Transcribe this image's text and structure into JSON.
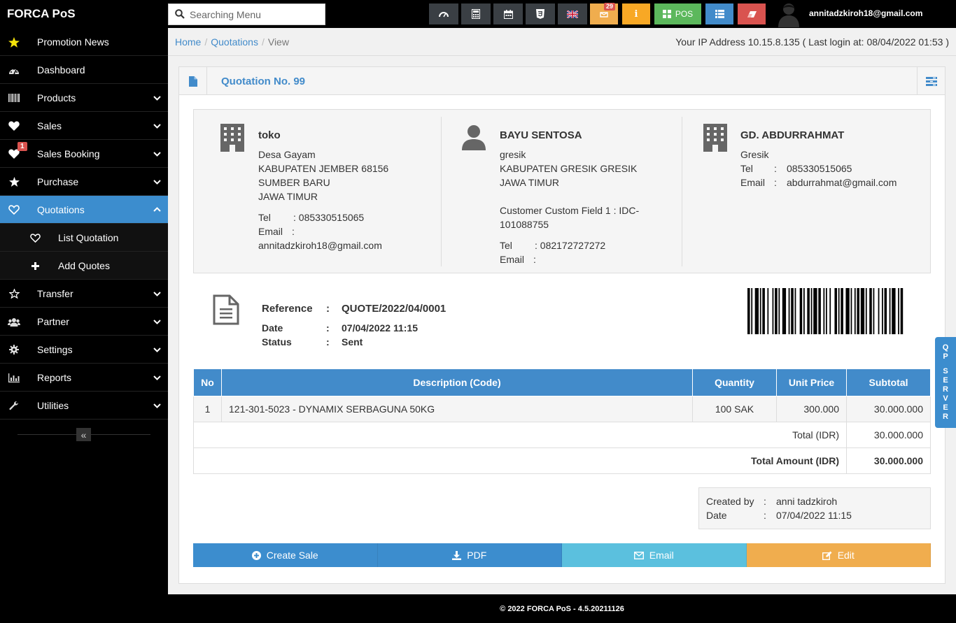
{
  "brand": "FORCA PoS",
  "search": {
    "placeholder": "Searching Menu"
  },
  "topbar": {
    "notifications_count": "29",
    "pos_label": "POS",
    "user_email": "annitadzkiroh18@gmail.com",
    "icons": [
      "dashboard-icon",
      "calculator-icon",
      "calendar-icon",
      "css-icon",
      "uk-flag-icon",
      "notification-icon",
      "info-icon",
      "pos-grid-icon",
      "list-icon",
      "eraser-icon"
    ]
  },
  "sidebar": {
    "items": [
      {
        "label": "Promotion News",
        "icon": "star-icon"
      },
      {
        "label": "Dashboard",
        "icon": "dashboard-icon"
      },
      {
        "label": "Products",
        "icon": "barcode-icon"
      },
      {
        "label": "Sales",
        "icon": "heart-icon"
      },
      {
        "label": "Sales Booking",
        "icon": "heart-icon",
        "badge": "1"
      },
      {
        "label": "Purchase",
        "icon": "star-icon"
      },
      {
        "label": "Quotations",
        "icon": "heart-outline-icon"
      },
      {
        "label": "Transfer",
        "icon": "star-outline-icon"
      },
      {
        "label": "Partner",
        "icon": "users-icon"
      },
      {
        "label": "Settings",
        "icon": "gear-icon"
      },
      {
        "label": "Reports",
        "icon": "bar-chart-icon"
      },
      {
        "label": "Utilities",
        "icon": "wrench-icon"
      }
    ],
    "subitems": [
      {
        "label": "List Quotation"
      },
      {
        "label": "Add Quotes"
      }
    ],
    "collapse_glyph": "«"
  },
  "breadcrumb": {
    "home": "Home",
    "quotations": "Quotations",
    "current": "View",
    "sep": "/"
  },
  "ip_info": "Your IP Address 10.15.8.135 ( Last login at: 08/04/2022 01:53 )",
  "quotation": {
    "title": "Quotation No. 99",
    "biller": {
      "name": "toko",
      "addr1": "Desa Gayam",
      "addr2": "KABUPATEN JEMBER 68156",
      "addr3": "SUMBER BARU",
      "addr4": "JAWA TIMUR",
      "tel_label": "Tel",
      "tel": ": 085330515065",
      "email_label": "Email",
      "email_sep": ":",
      "email": "annitadzkiroh18@gmail.com"
    },
    "customer": {
      "name": "BAYU SENTOSA",
      "addr1": "gresik",
      "addr2": "KABUPATEN GRESIK GRESIK",
      "addr3": "JAWA TIMUR",
      "custom1": "Customer Custom Field 1 : IDC-",
      "custom2": "101088755",
      "tel_label": "Tel",
      "tel": ": 082172727272",
      "email_label": "Email",
      "email_sep": ":"
    },
    "warehouse": {
      "name": "GD. ABDURRAHMAT",
      "addr1": "Gresik",
      "tel_label": "Tel",
      "tel_sep": ":",
      "tel": "085330515065",
      "email_label": "Email",
      "email_sep": ":",
      "email": "abdurrahmat@gmail.com"
    },
    "reference_label": "Reference",
    "reference": "QUOTE/2022/04/0001",
    "date_label": "Date",
    "date": "07/04/2022 11:15",
    "status_label": "Status",
    "status": "Sent",
    "colon": ":"
  },
  "table": {
    "headers": [
      "No",
      "Description (Code)",
      "Quantity",
      "Unit Price",
      "Subtotal"
    ],
    "rows": [
      {
        "no": "1",
        "desc": "121-301-5023 - DYNAMIX SERBAGUNA 50KG",
        "qty": "100 SAK",
        "price": "300.000",
        "subtotal": "30.000.000"
      }
    ],
    "total_label": "Total (IDR)",
    "total": "30.000.000",
    "total_amount_label": "Total Amount (IDR)",
    "total_amount": "30.000.000"
  },
  "created": {
    "by_label": "Created by",
    "by": "anni tadzkiroh",
    "date_label": "Date",
    "date": "07/04/2022 11:15",
    "sep": ":"
  },
  "actions": {
    "create_sale": "Create Sale",
    "pdf": "PDF",
    "email": "Email",
    "edit": "Edit"
  },
  "side_tab": [
    "Q",
    "P",
    "",
    "S",
    "E",
    "R",
    "V",
    "E",
    "R"
  ],
  "footer": "© 2022 FORCA PoS - 4.5.20211126",
  "colors": {
    "primary": "#428bca",
    "active_nav": "#3c8dce",
    "info": "#5bc0de",
    "warning": "#f0ad4e",
    "success": "#5cb85c",
    "danger": "#d9534f"
  }
}
